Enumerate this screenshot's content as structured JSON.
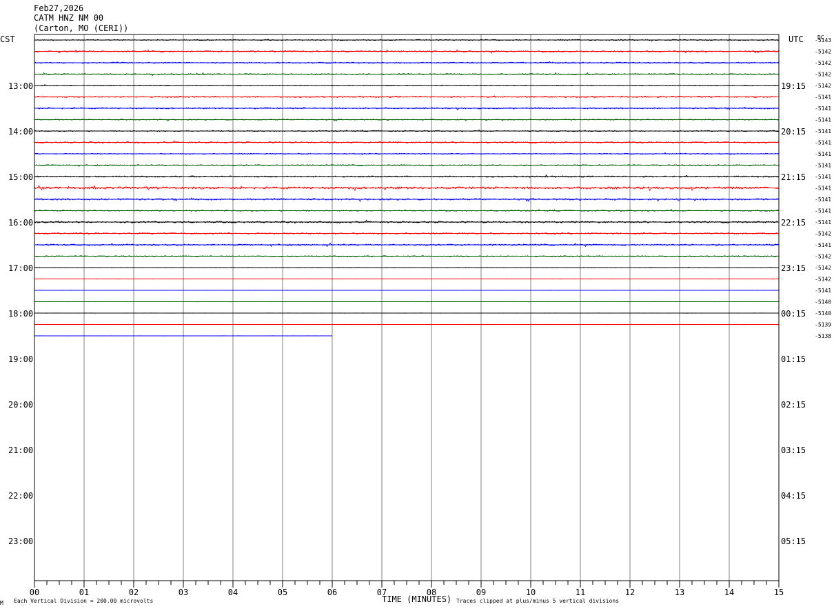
{
  "header": {
    "date": "Feb27,2026",
    "station": "CATM HNZ NM 00",
    "location": "(Carton, MO (CERI))"
  },
  "left_zone": "CST",
  "right_zone": "UTC",
  "dc_label": "DC",
  "footer": {
    "scale_note": "Each Vertical Division =  200.00 microvolts",
    "xlabel": "TIME (MINUTES)",
    "clip_note": "Traces clipped at plus/minus 5 vertical divisions",
    "corner_mark": "M"
  },
  "colors": {
    "black": "#000000",
    "red": "#ff0000",
    "blue": "#0000ff",
    "green": "#006400",
    "grid": "#808080"
  },
  "chart_data": {
    "type": "line",
    "title": "CATM HNZ NM 00",
    "xlabel": "TIME (MINUTES)",
    "xlim": [
      0,
      15
    ],
    "x_ticks": [
      "00",
      "01",
      "02",
      "03",
      "04",
      "05",
      "06",
      "07",
      "08",
      "09",
      "10",
      "11",
      "12",
      "13",
      "14",
      "15"
    ],
    "left_hour_labels": [
      "13:00",
      "14:00",
      "15:00",
      "16:00",
      "17:00",
      "18:00",
      "19:00",
      "20:00",
      "21:00",
      "22:00",
      "23:00"
    ],
    "right_hour_labels": [
      "19:15",
      "20:15",
      "21:15",
      "22:15",
      "23:15",
      "00:15",
      "01:15",
      "02:15",
      "03:15",
      "04:15",
      "05:15"
    ],
    "trace_color_cycle": [
      "black",
      "red",
      "blue",
      "green"
    ],
    "trace_count": 27,
    "last_trace_end_minute": 6,
    "dc_offsets": [
      "-5143",
      "-5142",
      "-5142",
      "-5142",
      "-5142",
      "-5141",
      "-5141",
      "-5141",
      "-5141",
      "-5141",
      "-5141",
      "-5141",
      "-5141",
      "-5141",
      "-5141",
      "-5141",
      "-5141",
      "-5142",
      "-5141",
      "-5142",
      "-5142",
      "-5142",
      "-5141",
      "-5140",
      "-5140",
      "-5139",
      "-5138"
    ],
    "trace_activity": [
      0.8,
      1.0,
      0.9,
      0.9,
      0.6,
      0.9,
      1.0,
      0.8,
      0.8,
      1.0,
      0.8,
      0.8,
      1.0,
      1.6,
      1.2,
      0.9,
      1.2,
      1.0,
      1.1,
      0.8,
      0.3,
      0.2,
      0.2,
      0.2,
      0.2,
      0.2,
      0.2
    ]
  }
}
